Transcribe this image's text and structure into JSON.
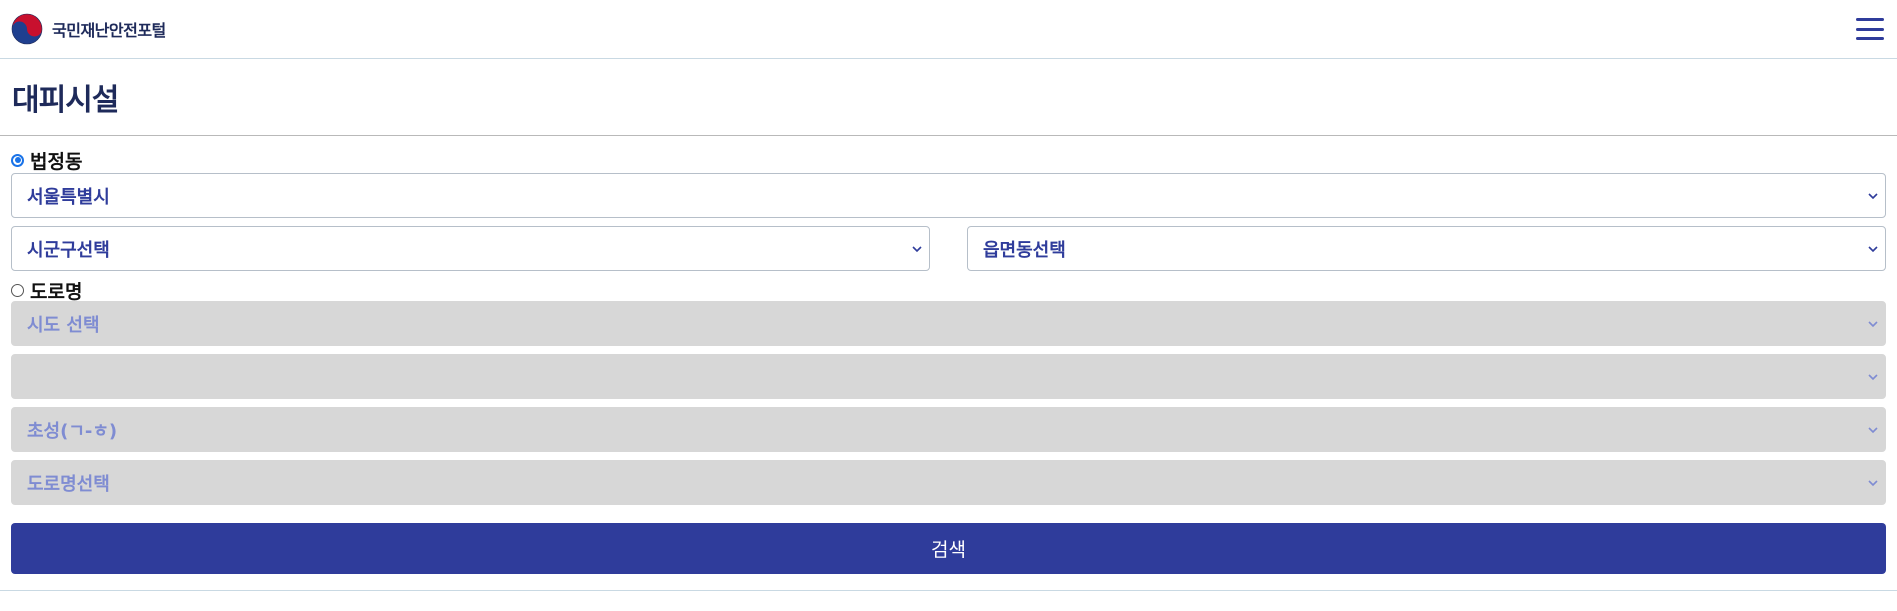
{
  "header": {
    "brand_text": "국민재난안전포털",
    "logo_icon": "taegeuk-emblem-icon",
    "menu_icon": "hamburger-menu-icon",
    "colors": {
      "brand_blue": "#2f3c9b",
      "emblem_red": "#c8102e",
      "emblem_blue": "#1f3f8f"
    }
  },
  "page": {
    "title": "대피시설"
  },
  "legal_dong": {
    "label": "법정동",
    "checked": true,
    "sido": "서울특별시",
    "sigungu": "시군구선택",
    "eupmyeondong": "읍면동선택"
  },
  "road_name": {
    "label": "도로명",
    "checked": false,
    "sido": "시도 선택",
    "sigungu": "",
    "initial": "초성(ㄱ-ㅎ)",
    "road": "도로명선택"
  },
  "search_button": {
    "label": "검색"
  }
}
